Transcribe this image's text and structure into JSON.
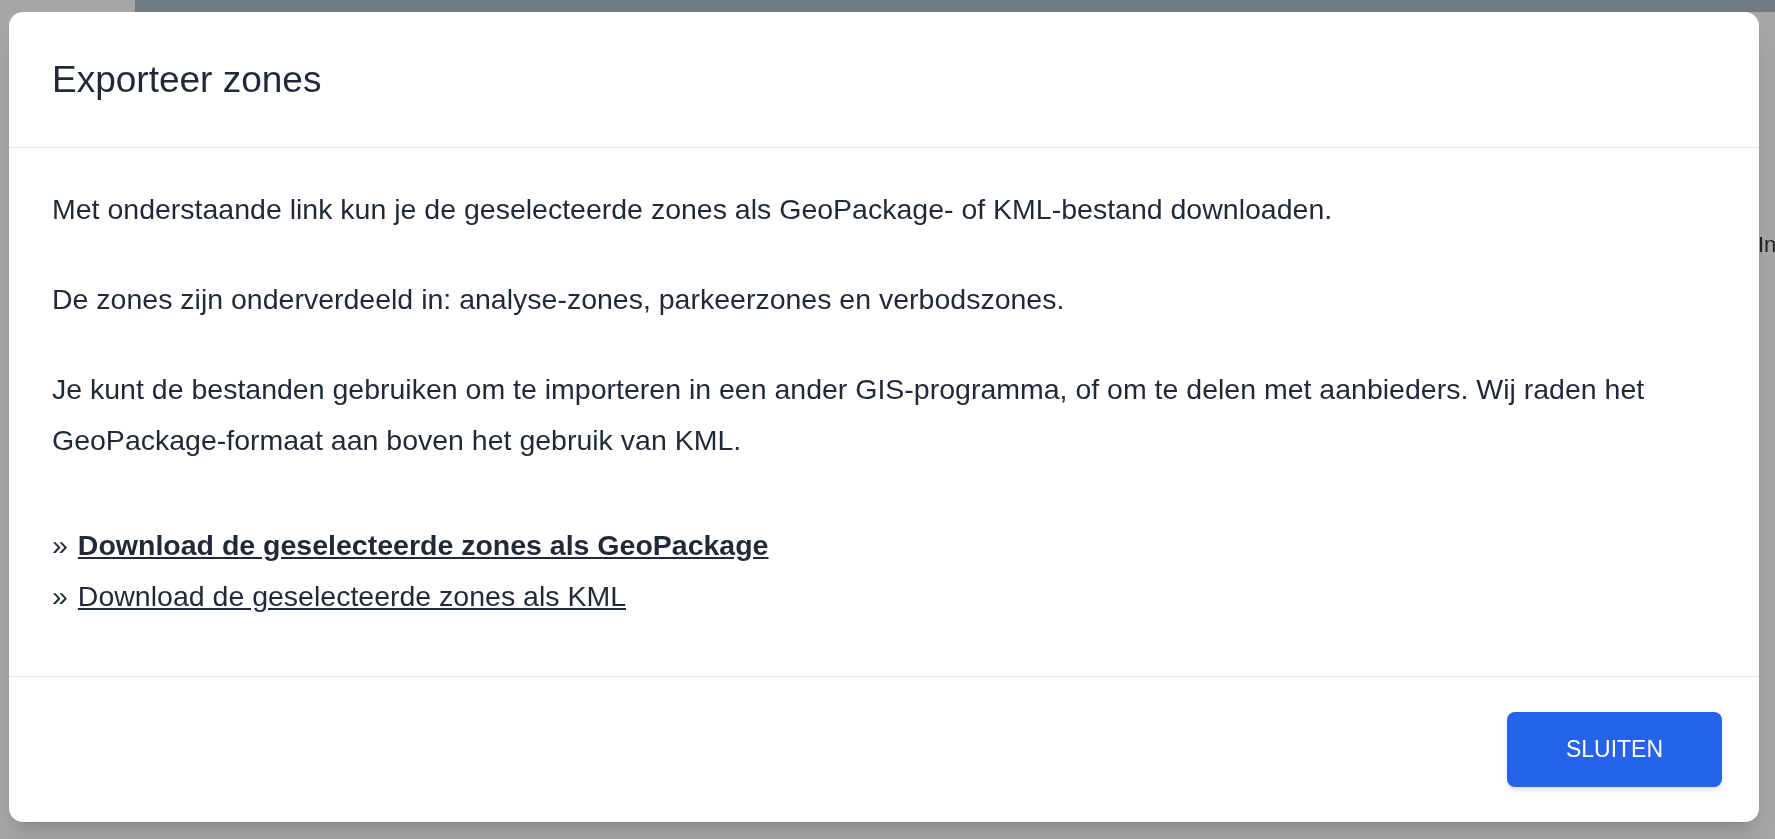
{
  "background": {
    "partial_text": "In"
  },
  "dialog": {
    "title": "Exporteer zones",
    "paragraphs": [
      "Met onderstaande link kun je de geselecteerde zones als GeoPackage- of KML-bestand downloaden.",
      "De zones zijn onderverdeeld in: analyse-zones, parkeerzones en verbodszones.",
      "Je kunt de bestanden gebruiken om te importeren in een ander GIS-programma, of om te delen met aanbieders. Wij raden het GeoPackage-formaat aan boven het gebruik van KML."
    ],
    "links": [
      {
        "prefix": "»",
        "label": "Download de geselecteerde zones als GeoPackage",
        "bold": true
      },
      {
        "prefix": "»",
        "label": "Download de geselecteerde zones als KML",
        "bold": false
      }
    ],
    "buttons": [
      "SLUITEN"
    ]
  }
}
